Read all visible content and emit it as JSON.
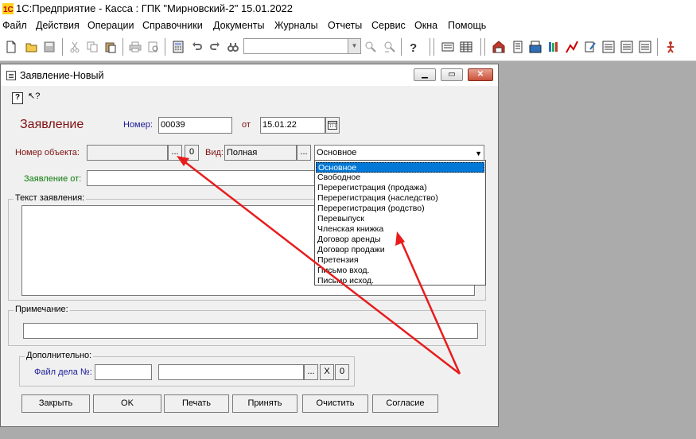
{
  "app": {
    "title": "1С:Предприятие - Касса :  ГПК \"Мирновский-2\"  15.01.2022",
    "menu": [
      "Файл",
      "Действия",
      "Операции",
      "Справочники",
      "Документы",
      "Журналы",
      "Отчеты",
      "Сервис",
      "Окна",
      "Помощь"
    ]
  },
  "window": {
    "title": "Заявление-Новый",
    "controls": {
      "minimize": "▁",
      "restore": "▭",
      "close": "✕"
    },
    "toolbar": {
      "help_icon": "?",
      "pointer_icon": "↖?"
    }
  },
  "form": {
    "heading": "Заявление",
    "number_label": "Номер:",
    "number_value": "00039",
    "date_label": "от",
    "date_value": "15.01.22",
    "object_label": "Номер объекта:",
    "object_value": "",
    "ellipsis": "...",
    "clear_zero": "0",
    "type_label": "Вид:",
    "type_value": "Полная",
    "kind_value": "Основное",
    "from_label": "Заявление от:",
    "from_value": "",
    "text_group_label": "Текст заявления:",
    "text_value": "",
    "note_group_label": "Примечание:",
    "note_value": "",
    "extra_group_label": "Дополнительно:",
    "case_file_label": "Файл дела №:",
    "case_file_num": "",
    "case_file_name": "",
    "clear_x": "X"
  },
  "dropdown": {
    "options": [
      "Основное",
      "Свободное",
      "Перерегистрация (продажа)",
      "Перерегистрация (наследство)",
      "Перерегистрация (родство)",
      "Перевыпуск",
      "Членская книжка",
      "Договор аренды",
      "Договор продажи",
      "Претензия",
      "Письмо вход.",
      "Письмо исход."
    ],
    "selected": 0
  },
  "buttons": {
    "close": "Закрыть",
    "ok": "OK",
    "print": "Печать",
    "accept": "Принять",
    "clear": "Очистить",
    "consent": "Согласие"
  },
  "colors": {
    "heading": "#7f1010",
    "label_red": "#7f1010",
    "label_green": "#0a7a0a",
    "label_blue": "#1a1a9a",
    "annotation": "#e81c1c",
    "selection": "#0078d7"
  }
}
